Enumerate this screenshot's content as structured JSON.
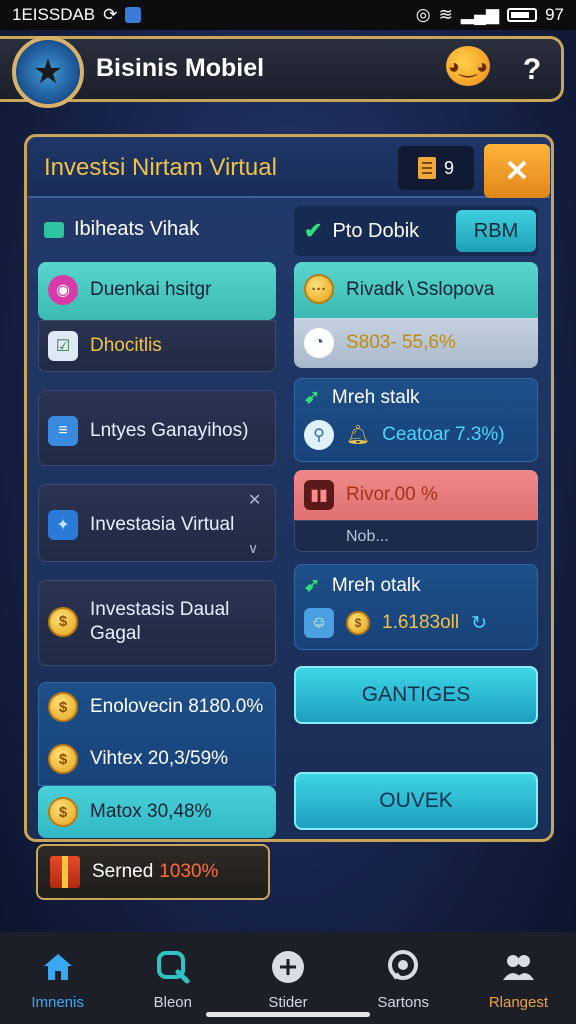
{
  "status_bar": {
    "time": "1ЕISSDAB",
    "battery": "97"
  },
  "header": {
    "title": "Bisinis Mobiel"
  },
  "panel": {
    "title": "Investsi Nirtam Virtual",
    "page_indicator": "9",
    "close_label": "✕"
  },
  "left": {
    "section_label": "Ibiheats Vihak",
    "items": [
      {
        "label": "Duenkai hsitgr"
      },
      {
        "label": "Dhocitlis"
      },
      {
        "label": "Lntyes Ganayihos)"
      },
      {
        "label": "Investasia Virtual"
      },
      {
        "label": "Investasis Daual\nGagal"
      },
      {
        "label": "Enolovecin 8180.0%"
      },
      {
        "label": "Vihtex 20,3/59%"
      },
      {
        "label": "Matox 30,48%"
      }
    ]
  },
  "right": {
    "section_label": "Pto Dobik",
    "rbm_label": "RBM",
    "cards": [
      {
        "label": "Rivadk∖Sslopova"
      },
      {
        "label": "S803- 55,6%"
      },
      {
        "title": "Mreh stalk",
        "value": "Ceatoar 7.3%)"
      },
      {
        "label": "Rivor.00 %",
        "sub": "Nob..."
      },
      {
        "title": "Mreh otalk",
        "value": "1.6183oll"
      }
    ],
    "buttons": [
      "GANTIGES",
      "OUVEK"
    ]
  },
  "served": {
    "label": "Serned",
    "value": "1030%"
  },
  "nav": [
    {
      "label": "Imnenis",
      "icon": "home-icon"
    },
    {
      "label": "Bleon",
      "icon": "search-icon"
    },
    {
      "label": "Stider",
      "icon": "plus-icon"
    },
    {
      "label": "Sartons",
      "icon": "chat-icon"
    },
    {
      "label": "Rlangest",
      "icon": "users-icon"
    }
  ],
  "colors": {
    "accent_gold": "#c9a55a",
    "title_gold": "#f0c348",
    "teal": "#3ed6e6",
    "orange": "#e0861a"
  }
}
